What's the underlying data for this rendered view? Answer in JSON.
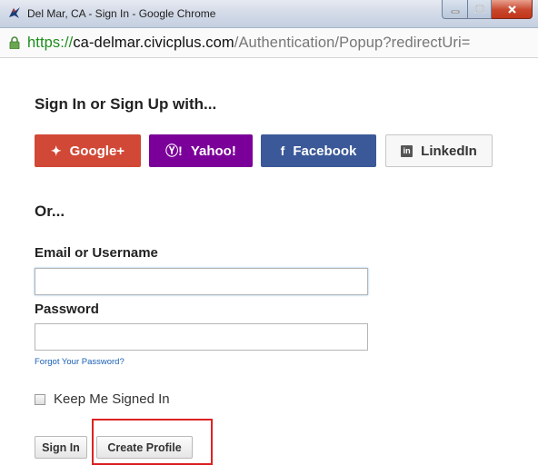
{
  "window": {
    "title": "Del Mar, CA - Sign In - Google Chrome"
  },
  "address_bar": {
    "scheme": "https://",
    "host": "ca-delmar.civicplus.com",
    "path": "/Authentication/Popup?redirectUri="
  },
  "signin": {
    "heading": "Sign In or Sign Up with...",
    "providers": [
      {
        "label": "Google+",
        "icon": "google-plus-icon",
        "glyph": "✦",
        "color": "#d14836"
      },
      {
        "label": "Yahoo!",
        "icon": "yahoo-icon",
        "glyph": "Ⓨ!",
        "color": "#7b0099"
      },
      {
        "label": "Facebook",
        "icon": "facebook-icon",
        "glyph": "f",
        "color": "#3b5998"
      },
      {
        "label": "LinkedIn",
        "icon": "linkedin-icon",
        "glyph": "in",
        "color": "#f7f7f7"
      }
    ],
    "or_label": "Or...",
    "email_label": "Email or Username",
    "email_value": "",
    "password_label": "Password",
    "password_value": "",
    "forgot_label": "Forgot Your Password?",
    "keep_signed_in_label": "Keep Me Signed In",
    "keep_signed_in_checked": false,
    "signin_button": "Sign In",
    "create_profile_button": "Create Profile"
  },
  "colors": {
    "highlight": "#dd2222",
    "link": "#1a5fb4",
    "secure_scheme": "#1e8d1e"
  }
}
